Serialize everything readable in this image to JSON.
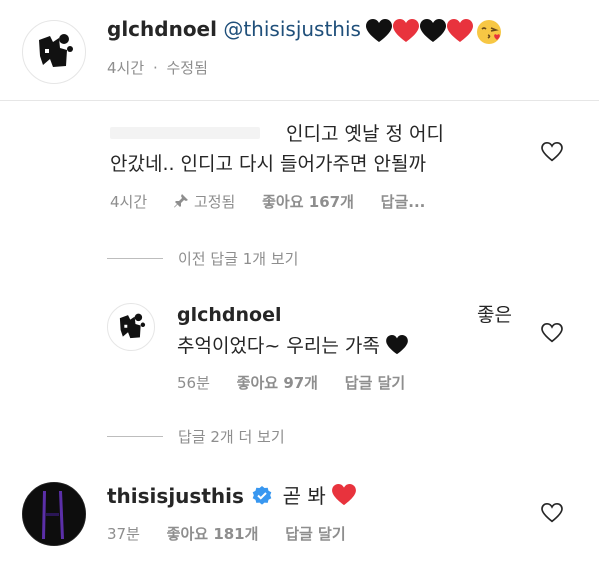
{
  "caption": {
    "username": "glchdnoel",
    "mention": "@thisisjusthis",
    "emojis": [
      "black-heart",
      "red-heart",
      "black-heart",
      "red-heart",
      "kiss-face"
    ],
    "time": "4시간",
    "edited": "수정됨"
  },
  "comment1": {
    "line1": "인디고 옛날 정 어디",
    "line2": "안갔네.. 인디고 다시 들어가주면 안될까",
    "time": "4시간",
    "pinned": "고정됨",
    "likes_label": "좋아요",
    "likes_count": "167개",
    "reply": "답글..."
  },
  "view_prev_replies": "이전 답글 1개 보기",
  "reply1": {
    "username": "glchdnoel",
    "text_line1_end": "좋은",
    "text_line2": "추억이었다~ 우리는 가족",
    "time": "56분",
    "likes_label": "좋아요",
    "likes_count": "97개",
    "reply": "답글 달기"
  },
  "view_more_replies": "답글 2개 더 보기",
  "comment2": {
    "username": "thisisjusthis",
    "text": "곧 봐",
    "time": "37분",
    "likes_label": "좋아요",
    "likes_count": "181개",
    "reply": "답글 달기"
  },
  "colors": {
    "red_heart": "#e8333d",
    "black_heart": "#111111",
    "verified": "#3897f0",
    "purple": "#5b2fa8"
  }
}
